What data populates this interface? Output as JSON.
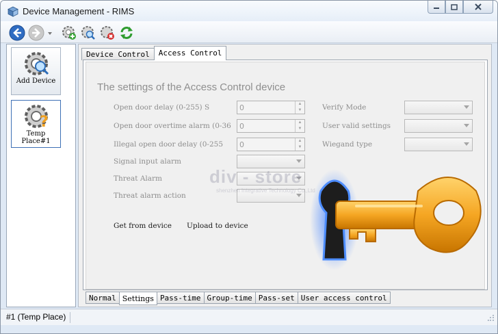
{
  "window": {
    "title": "Device Management - RIMS"
  },
  "toolbar": {
    "buttons": [
      {
        "icon": "back-arrow-icon"
      },
      {
        "icon": "forward-arrow-icon"
      },
      {
        "icon": "add-device-icon"
      },
      {
        "icon": "search-device-icon"
      },
      {
        "icon": "delete-device-icon"
      },
      {
        "icon": "refresh-icon"
      }
    ]
  },
  "sidebar": {
    "add_device_label": "Add Device",
    "place_label": "Temp Place#1"
  },
  "tabs_top": [
    "Device Control",
    "Access Control"
  ],
  "active_top_tab": "Access Control",
  "settings": {
    "heading": "The settings of the Access Control device",
    "open_door_delay_label": "Open door delay (0-255) S",
    "open_door_delay_value": "0",
    "overtime_alarm_label": "Open door overtime alarm (0-36",
    "overtime_alarm_value": "0",
    "illegal_open_label": "Illegal open door delay (0-255",
    "illegal_open_value": "0",
    "signal_input_label": "Signal input alarm",
    "threat_alarm_label": "Threat Alarm",
    "threat_action_label": "Threat alarm action",
    "verify_mode_label": "Verify Mode",
    "user_valid_label": "User valid settings",
    "wiegand_label": "Wiegand type",
    "get_from_device": "Get from device",
    "upload_to_device": "Upload to device"
  },
  "watermark": {
    "main": "div - store",
    "sub": "shenzhen Integrative Technology Co.,Ltd"
  },
  "tabs_bottom": [
    "Normal",
    "Settings",
    "Pass-time",
    "Group-time",
    "Pass-set",
    "User access control"
  ],
  "active_bottom_tab": "Settings",
  "status": {
    "text": "#1 (Temp Place)"
  },
  "colors": {
    "accent": "#3c6fb5",
    "key_gold": "#f5a623",
    "disabled_text": "#8d8d8d"
  }
}
